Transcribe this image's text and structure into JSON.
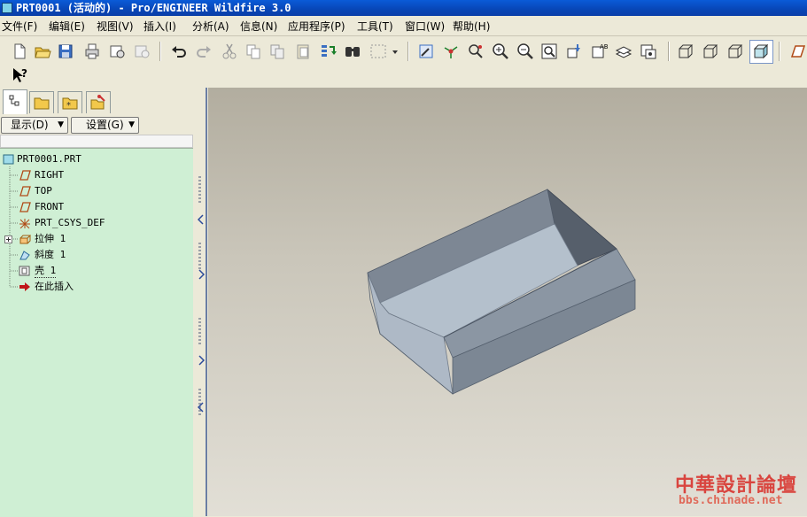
{
  "window": {
    "title": "PRT0001 (活动的) - Pro/ENGINEER Wildfire 3.0"
  },
  "menubar": {
    "items": [
      "文件(F)",
      "编辑(E)",
      "视图(V)",
      "插入(I)",
      "分析(A)",
      "信息(N)",
      "应用程序(P)",
      "工具(T)",
      "窗口(W)",
      "帮助(H)"
    ]
  },
  "toolbar": {
    "icons": [
      "new-icon",
      "open-icon",
      "save-icon",
      "print-icon",
      "send-icon",
      "close-window-icon",
      "undo-icon",
      "redo-icon",
      "cut-icon",
      "copy-icon",
      "paste-icon",
      "paste-special-icon",
      "regenerate-icon",
      "find-icon",
      "select-box-icon",
      "repaint-icon",
      "spin-center-icon",
      "orient-icon",
      "zoom-in-icon",
      "zoom-out-icon",
      "refit-icon",
      "reorient-icon",
      "saved-views-icon",
      "layers-icon",
      "view-manager-icon",
      "wireframe-icon",
      "hidden-line-icon",
      "no-hidden-icon",
      "shading-icon",
      "datum-plane-icon",
      "whats-this-icon"
    ]
  },
  "navigator": {
    "tabs": [
      "model-tree-icon",
      "folder-browser-icon",
      "favorites-icon",
      "connections-icon"
    ],
    "show_dropdown": "显示(D)",
    "settings_dropdown": "设置(G)"
  },
  "model_tree": {
    "root": "PRT0001.PRT",
    "items": [
      {
        "label": "RIGHT",
        "icon": "datum-plane-icon"
      },
      {
        "label": "TOP",
        "icon": "datum-plane-icon"
      },
      {
        "label": "FRONT",
        "icon": "datum-plane-icon"
      },
      {
        "label": "PRT_CSYS_DEF",
        "icon": "csys-icon"
      },
      {
        "label": "拉伸 1",
        "icon": "extrude-icon"
      },
      {
        "label": "斜度 1",
        "icon": "draft-icon"
      },
      {
        "label": "壳 1",
        "icon": "shell-icon"
      },
      {
        "label": "在此插入",
        "icon": "insert-here-arrow-icon"
      }
    ]
  },
  "watermark": {
    "brand": "中華設計論壇",
    "url": "bbs.chinade.net"
  },
  "colors": {
    "title_bar": "#0846b6",
    "tree_background": "#cfefd4",
    "model_dark": "#6b7482",
    "model_light": "#b9c4d0",
    "watermark": "#d9453f"
  }
}
